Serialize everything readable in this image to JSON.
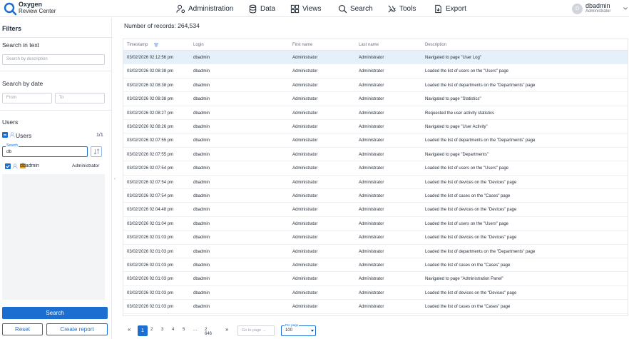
{
  "app": {
    "brand_line1": "Oxygen",
    "brand_line2": "Review Center"
  },
  "nav": [
    {
      "label": "Administration",
      "icon": "user-gear-icon"
    },
    {
      "label": "Data",
      "icon": "database-icon"
    },
    {
      "label": "Views",
      "icon": "grid-icon"
    },
    {
      "label": "Search",
      "icon": "search-icon"
    },
    {
      "label": "Tools",
      "icon": "tools-icon"
    },
    {
      "label": "Export",
      "icon": "export-icon"
    }
  ],
  "user": {
    "avatar_initial": "D",
    "name": "dbadmin",
    "role": "Administrator"
  },
  "sidebar": {
    "title": "Filters",
    "search_text": {
      "heading": "Search in text",
      "placeholder": "Search by description"
    },
    "search_date": {
      "heading": "Search by date",
      "from_placeholder": "From",
      "to_placeholder": "To"
    },
    "users": {
      "heading": "Users",
      "group_label": "Users",
      "count": "1/1",
      "search_legend": "Search",
      "search_value": "db",
      "items": [
        {
          "match": "db",
          "rest": "admin",
          "role": "Administrator"
        }
      ]
    },
    "search_button": "Search",
    "reset_button": "Reset",
    "report_button": "Create report"
  },
  "main": {
    "records_label": "Number of records: 264,534",
    "columns": [
      "Timestamp",
      "Login",
      "First name",
      "Last name",
      "Description"
    ],
    "rows": [
      [
        "03/02/2026 02:12:56 pm",
        "dbadmin",
        "Administrator",
        "Administrator",
        "Navigated to page \"User Log\""
      ],
      [
        "03/02/2026 02:08:38 pm",
        "dbadmin",
        "Administrator",
        "Administrator",
        "Loaded the list of users on the \"Users\" page"
      ],
      [
        "03/02/2026 02:08:38 pm",
        "dbadmin",
        "Administrator",
        "Administrator",
        "Loaded the list of departments on the \"Departments\" page"
      ],
      [
        "03/02/2026 02:08:38 pm",
        "dbadmin",
        "Administrator",
        "Administrator",
        "Navigated to page \"Statistics\""
      ],
      [
        "03/02/2026 02:08:27 pm",
        "dbadmin",
        "Administrator",
        "Administrator",
        "Requested the user activity statistics"
      ],
      [
        "03/02/2026 02:08:26 pm",
        "dbadmin",
        "Administrator",
        "Administrator",
        "Navigated to page \"User Activity\""
      ],
      [
        "03/02/2026 02:07:55 pm",
        "dbadmin",
        "Administrator",
        "Administrator",
        "Loaded the list of departments on the \"Departments\" page"
      ],
      [
        "03/02/2026 02:07:55 pm",
        "dbadmin",
        "Administrator",
        "Administrator",
        "Navigated to page \"Departments\""
      ],
      [
        "03/02/2026 02:07:54 pm",
        "dbadmin",
        "Administrator",
        "Administrator",
        "Loaded the list of users on the \"Users\" page"
      ],
      [
        "03/02/2026 02:07:54 pm",
        "dbadmin",
        "Administrator",
        "Administrator",
        "Loaded the list of devices on the \"Devices\" page"
      ],
      [
        "03/02/2026 02:07:54 pm",
        "dbadmin",
        "Administrator",
        "Administrator",
        "Loaded the list of cases on the \"Cases\" page"
      ],
      [
        "03/02/2026 02:04:48 pm",
        "dbadmin",
        "Administrator",
        "Administrator",
        "Loaded the list of devices on the \"Devices\" page"
      ],
      [
        "03/02/2026 02:01:04 pm",
        "dbadmin",
        "Administrator",
        "Administrator",
        "Loaded the list of users on the \"Users\" page"
      ],
      [
        "03/02/2026 02:01:03 pm",
        "dbadmin",
        "Administrator",
        "Administrator",
        "Loaded the list of devices on the \"Devices\" page"
      ],
      [
        "03/02/2026 02:01:03 pm",
        "dbadmin",
        "Administrator",
        "Administrator",
        "Loaded the list of departments on the \"Departments\" page"
      ],
      [
        "03/02/2026 02:01:03 pm",
        "dbadmin",
        "Administrator",
        "Administrator",
        "Loaded the list of cases on the \"Cases\" page"
      ],
      [
        "03/02/2026 02:01:03 pm",
        "dbadmin",
        "Administrator",
        "Administrator",
        "Navigated to page \"Administration Panel\""
      ],
      [
        "03/02/2026 02:01:03 pm",
        "dbadmin",
        "Administrator",
        "Administrator",
        "Loaded the list of devices on the \"Devices\" page"
      ],
      [
        "03/02/2026 02:01:03 pm",
        "dbadmin",
        "Administrator",
        "Administrator",
        "Loaded the list of cases on the \"Cases\" page"
      ]
    ]
  },
  "pagination": {
    "first": "«",
    "pages": [
      "1",
      "2",
      "3",
      "4",
      "5"
    ],
    "ellipsis": "...",
    "last_page": "2 646",
    "next": "»",
    "goto_placeholder": "Go to page →",
    "per_page_legend": "Per page",
    "per_page_value": "100"
  },
  "colors": {
    "accent": "#1c6fd1",
    "selected_row": "#e6f0fb",
    "highlight": "#f59e0b"
  }
}
